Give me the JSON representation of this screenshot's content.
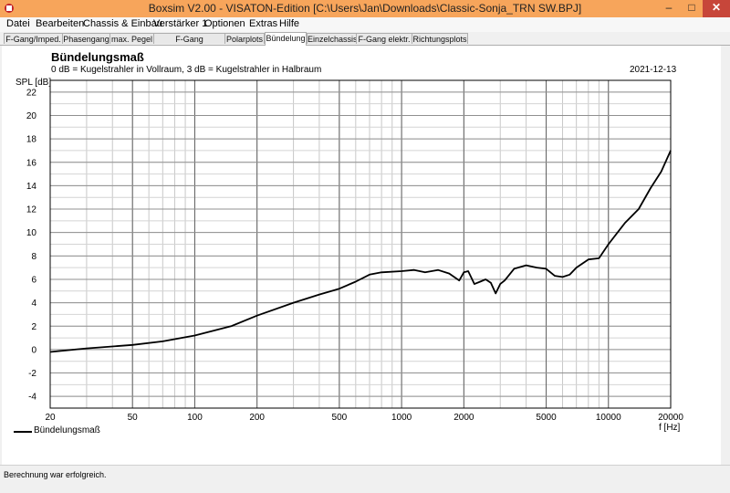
{
  "window": {
    "title": "Boxsim V2.00 - VISATON-Edition [C:\\Users\\Jan\\Downloads\\Classic-Sonja_TRN SW.BPJ]",
    "min_label": "–",
    "max_label": "□",
    "close_label": "✕"
  },
  "menu": {
    "items": [
      "Datei",
      "Bearbeiten",
      "Chassis & Einbau",
      "Verstärker 1",
      "Optionen",
      "Extras",
      "Hilfe"
    ]
  },
  "tabs": {
    "items": [
      "F-Gang/Imped.",
      "Phasengang",
      "max. Pegel",
      "F-Gang Richtungen",
      "Polarplots",
      "Bündelung",
      "Einzelchassis",
      "F-Gang elektr.",
      "Richtungsplots"
    ],
    "active": 5
  },
  "chart": {
    "title": "Bündelungsmaß",
    "subtitle": "0 dB = Kugelstrahler in Vollraum, 3 dB = Kugelstrahler in Halbraum",
    "date": "2021-12-13"
  },
  "status": {
    "text": "Berechnung war erfolgreich."
  },
  "colors": {
    "titlebar": "#f7a55b",
    "close": "#c7463a",
    "curve": "#000000"
  },
  "chart_data": {
    "type": "line",
    "title": "Bündelungsmaß",
    "xlabel": "f [Hz]",
    "ylabel": "SPL [dB]",
    "xscale": "log",
    "xlim": [
      20,
      20000
    ],
    "ylim": [
      -5,
      23
    ],
    "xticks": [
      20,
      50,
      100,
      200,
      500,
      1000,
      2000,
      5000,
      10000,
      20000
    ],
    "yticks": [
      -4,
      -2,
      0,
      2,
      4,
      6,
      8,
      10,
      12,
      14,
      16,
      18,
      20,
      22
    ],
    "grid": true,
    "legend": "bottom-left",
    "series": [
      {
        "name": "Bündelungsmaß",
        "x": [
          20,
          30,
          50,
          70,
          100,
          150,
          200,
          300,
          400,
          500,
          600,
          700,
          800,
          1000,
          1150,
          1300,
          1500,
          1700,
          1900,
          2000,
          2100,
          2250,
          2400,
          2550,
          2700,
          2850,
          3000,
          3150,
          3500,
          4000,
          4500,
          5000,
          5500,
          6000,
          6500,
          7000,
          8000,
          9000,
          10000,
          12000,
          14000,
          16000,
          18000,
          20000
        ],
        "y": [
          -0.2,
          0.1,
          0.4,
          0.7,
          1.2,
          2.0,
          2.9,
          4.0,
          4.7,
          5.2,
          5.8,
          6.4,
          6.6,
          6.7,
          6.8,
          6.6,
          6.8,
          6.5,
          5.9,
          6.6,
          6.7,
          5.6,
          5.8,
          6.0,
          5.7,
          4.8,
          5.6,
          5.9,
          6.9,
          7.2,
          7.0,
          6.9,
          6.3,
          6.2,
          6.4,
          7.0,
          7.7,
          7.8,
          9.0,
          10.8,
          12.0,
          13.8,
          15.2,
          17.0
        ]
      }
    ]
  }
}
